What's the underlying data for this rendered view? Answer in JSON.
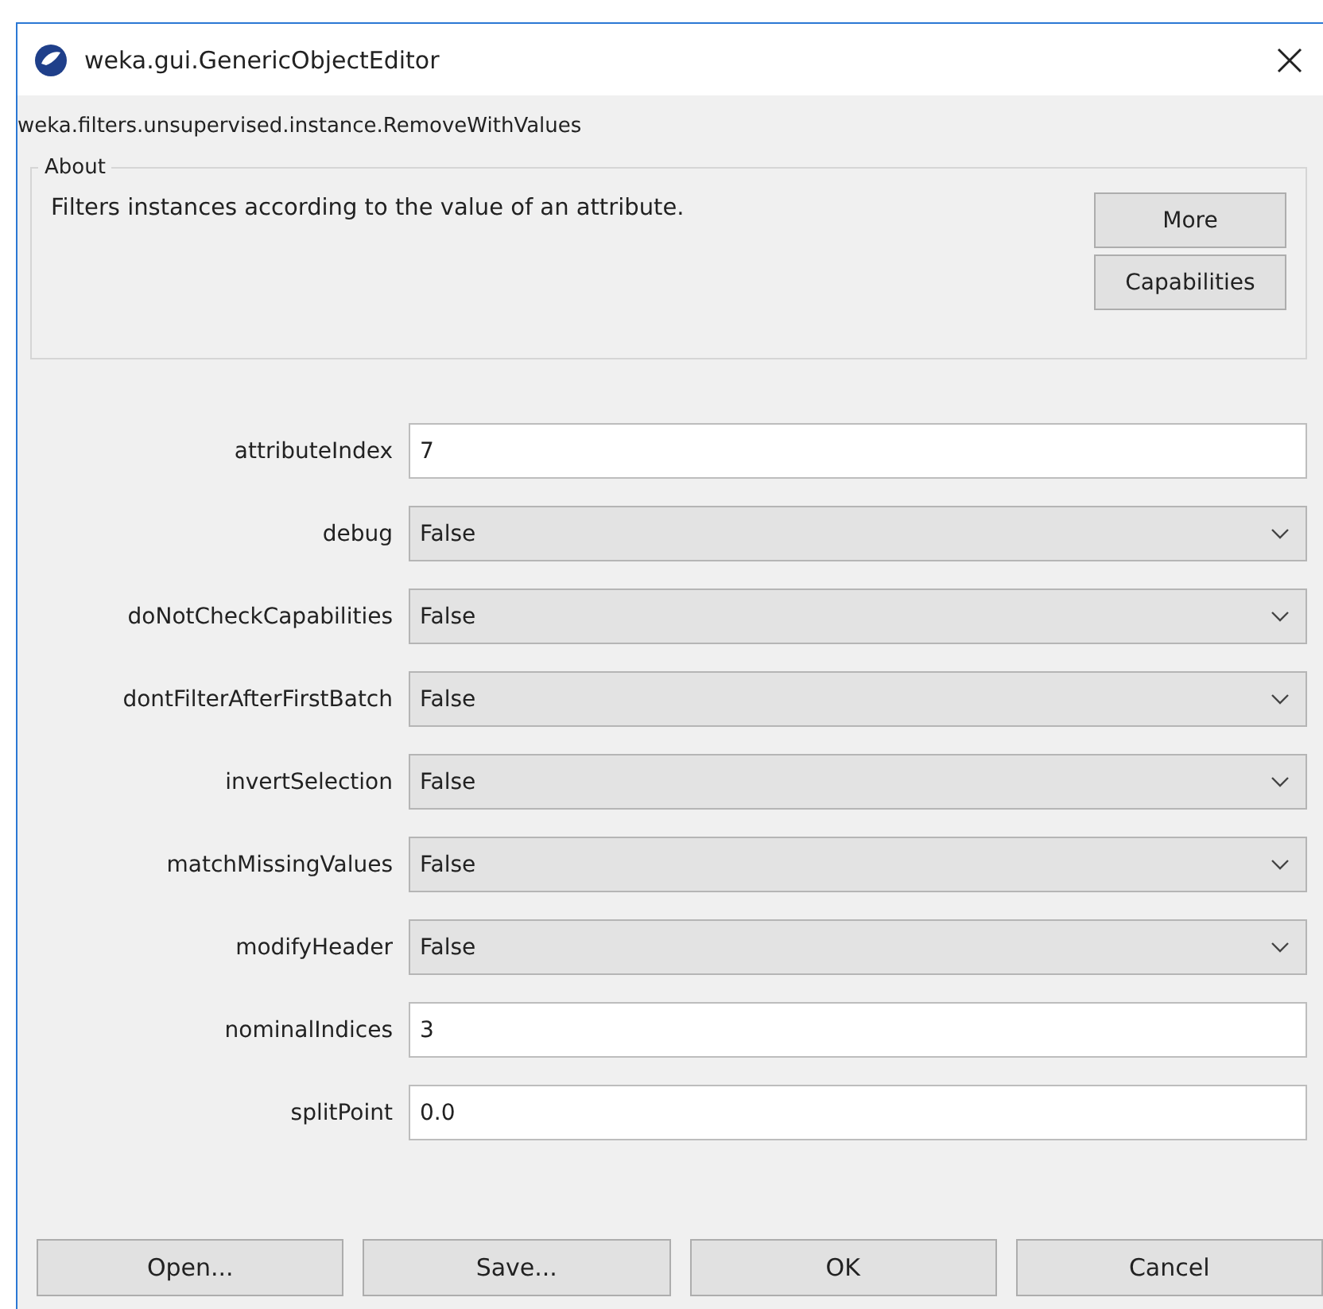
{
  "window": {
    "title": "weka.gui.GenericObjectEditor"
  },
  "class_name": "weka.filters.unsupervised.instance.RemoveWithValues",
  "about": {
    "title": "About",
    "description": "Filters instances according to the value of an attribute.",
    "buttons": [
      "More",
      "Capabilities"
    ]
  },
  "properties": [
    {
      "label": "attributeIndex",
      "kind": "text",
      "value": "7"
    },
    {
      "label": "debug",
      "kind": "dropdown",
      "value": "False"
    },
    {
      "label": "doNotCheckCapabilities",
      "kind": "dropdown",
      "value": "False"
    },
    {
      "label": "dontFilterAfterFirstBatch",
      "kind": "dropdown",
      "value": "False"
    },
    {
      "label": "invertSelection",
      "kind": "dropdown",
      "value": "False"
    },
    {
      "label": "matchMissingValues",
      "kind": "dropdown",
      "value": "False"
    },
    {
      "label": "modifyHeader",
      "kind": "dropdown",
      "value": "False"
    },
    {
      "label": "nominalIndices",
      "kind": "text",
      "value": "3"
    },
    {
      "label": "splitPoint",
      "kind": "text",
      "value": "0.0"
    }
  ],
  "buttons": [
    "Open...",
    "Save...",
    "OK",
    "Cancel"
  ]
}
